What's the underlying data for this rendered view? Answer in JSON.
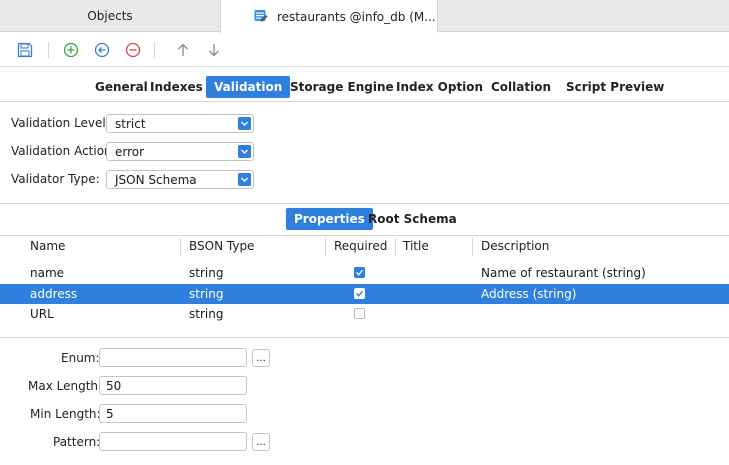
{
  "tabs": {
    "objects": "Objects",
    "active": "restaurants @info_db (M..."
  },
  "toolbar": {
    "buttons": [
      "save-icon",
      "add-icon",
      "insert-left-icon",
      "remove-icon",
      "move-up-icon",
      "move-down-icon"
    ]
  },
  "subtabs": [
    "General",
    "Indexes",
    "Validation",
    "Storage Engine",
    "Index Option",
    "Collation",
    "Script Preview"
  ],
  "validation": {
    "level_label": "Validation Level:",
    "level_value": "strict",
    "action_label": "Validation Action:",
    "action_value": "error",
    "type_label": "Validator Type:",
    "type_value": "JSON Schema"
  },
  "schema_tabs": [
    "Properties",
    "Root Schema"
  ],
  "table": {
    "headers": [
      "Name",
      "BSON Type",
      "Required",
      "Title",
      "Description"
    ],
    "rows": [
      {
        "name": "name",
        "bson_type": "string",
        "required": true,
        "title": "",
        "description": "Name of restaurant (string)"
      },
      {
        "name": "address",
        "bson_type": "string",
        "required": true,
        "title": "",
        "description": "Address (string)"
      },
      {
        "name": "URL",
        "bson_type": "string",
        "required": false,
        "title": "",
        "description": ""
      }
    ]
  },
  "props": {
    "enum_label": "Enum:",
    "enum_value": "",
    "max_length_label": "Max Length:",
    "max_length_value": "50",
    "min_length_label": "Min Length:",
    "min_length_value": "5",
    "pattern_label": "Pattern:",
    "pattern_value": "",
    "dots": "..."
  },
  "colors": {
    "accent": "#2f7fde",
    "add": "#3aa63a",
    "remove": "#e0443c"
  }
}
